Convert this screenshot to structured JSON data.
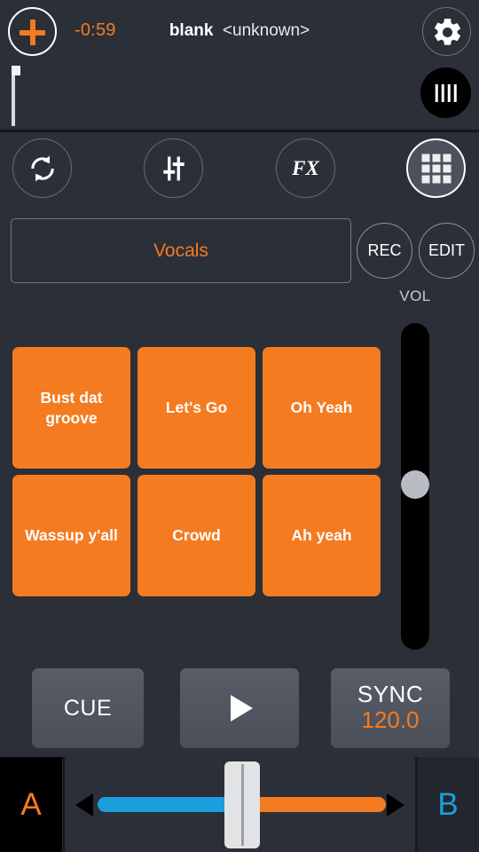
{
  "header": {
    "add_button": {
      "icon": "plus-icon"
    },
    "time_remaining": "-0:59",
    "track_title": "blank",
    "track_artist": "<unknown>",
    "settings_icon": "gear-icon",
    "bars_icon": "beatgrid-bars-icon",
    "waveform": {
      "playhead_icon": "playhead-marker"
    }
  },
  "toolbar": {
    "items": [
      {
        "name": "loop",
        "icon": "loop-icon",
        "label": "",
        "active": false
      },
      {
        "name": "eq",
        "icon": "eq-sliders-icon",
        "label": "",
        "active": false
      },
      {
        "name": "fx",
        "icon": "fx-icon",
        "label": "FX",
        "active": false
      },
      {
        "name": "pads",
        "icon": "grid-icon",
        "label": "",
        "active": true
      }
    ]
  },
  "bank": {
    "name": "Vocals",
    "rec_label": "REC",
    "edit_label": "EDIT"
  },
  "volume": {
    "label": "VOL",
    "value_percent": 50
  },
  "pads": [
    {
      "label": "Bust dat groove"
    },
    {
      "label": "Let's Go"
    },
    {
      "label": "Oh Yeah"
    },
    {
      "label": "Wassup y'all"
    },
    {
      "label": "Crowd"
    },
    {
      "label": "Ah yeah"
    }
  ],
  "transport": {
    "cue_label": "CUE",
    "play_icon": "play-icon",
    "sync_label": "SYNC",
    "bpm_value": "120.0"
  },
  "crossfader": {
    "deck_a_label": "A",
    "deck_b_label": "B",
    "position_percent": 50,
    "left_arrow_icon": "triangle-left-icon",
    "right_arrow_icon": "triangle-right-icon"
  },
  "colors": {
    "accent_orange": "#f47b20",
    "accent_blue": "#1b9fdc",
    "background": "#2b2f38",
    "button_grey": "#50555f"
  }
}
